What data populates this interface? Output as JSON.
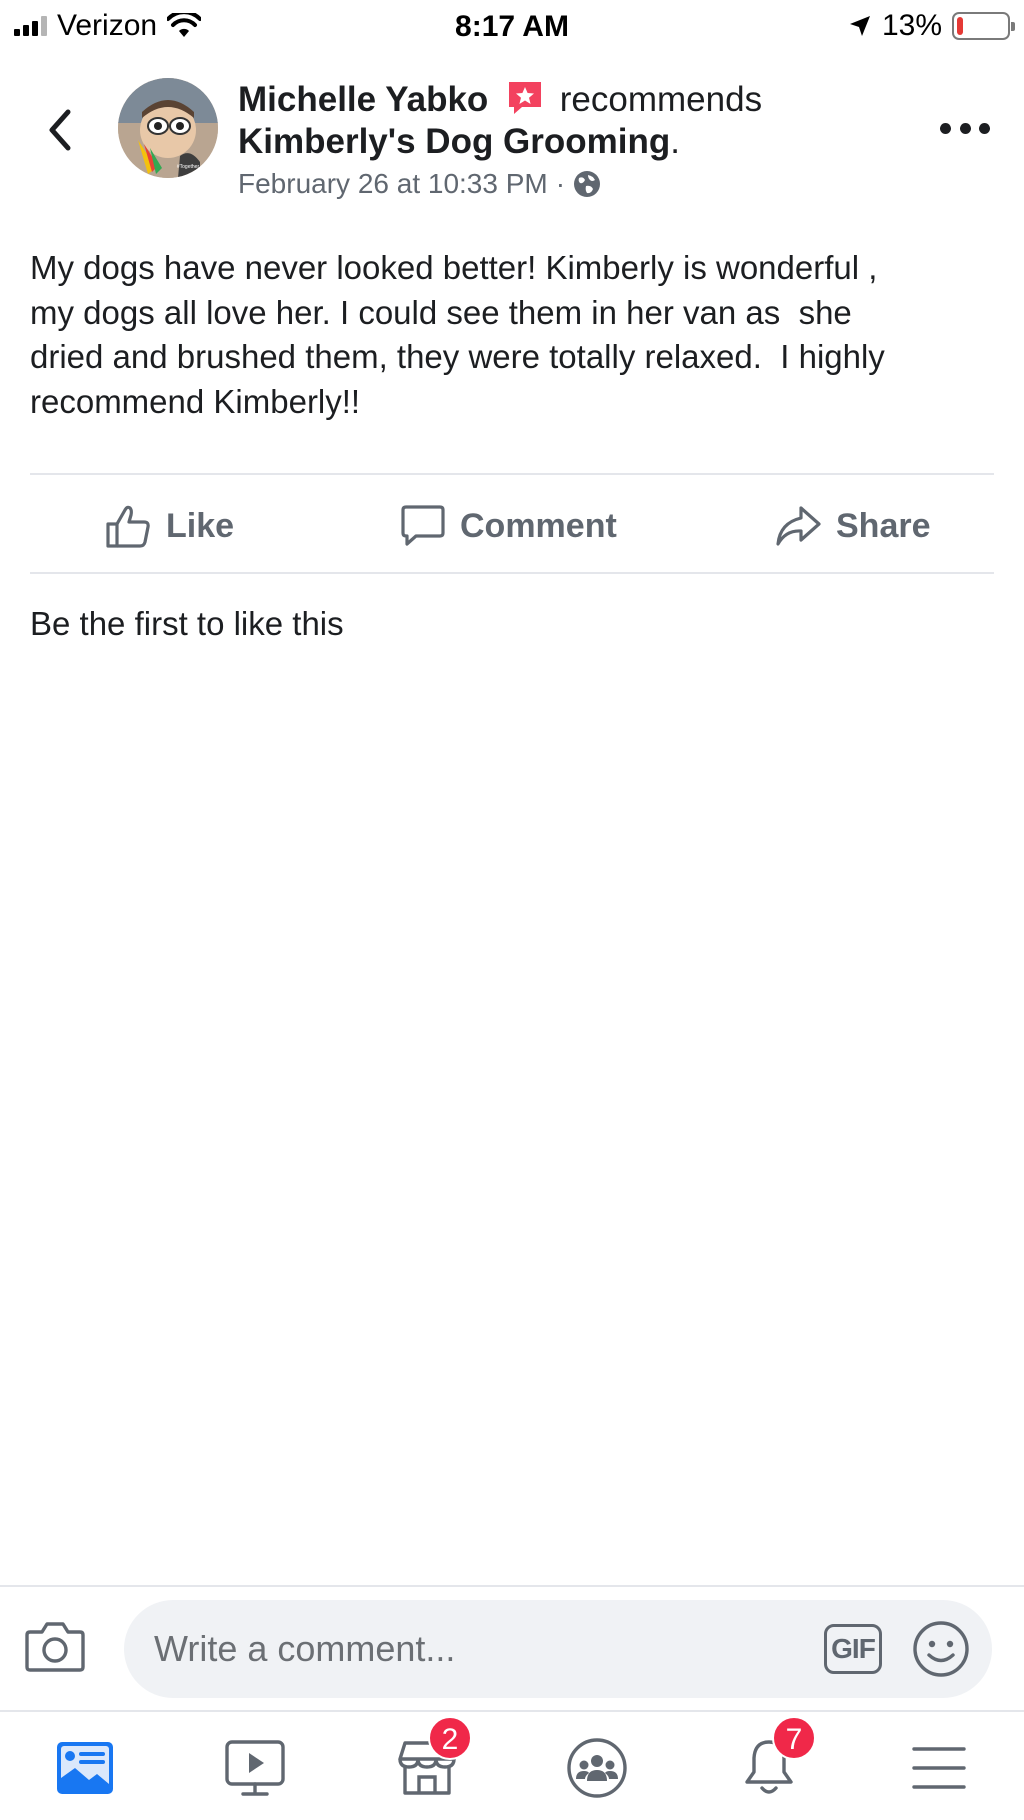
{
  "status_bar": {
    "carrier": "Verizon",
    "time": "8:17 AM",
    "battery_text": "13%",
    "battery_level": 0.13,
    "battery_color": "#e53935"
  },
  "post": {
    "author": "Michelle Yabko",
    "recommendation_icon": "recommendation-star-icon",
    "action_word": "recommends",
    "page_name": "Kimberly's Dog Grooming",
    "page_suffix": ".",
    "timestamp": "February 26 at 10:33 PM",
    "separator": "·",
    "privacy_icon": "globe-icon",
    "text": "My dogs have never looked better! Kimberly is wonderful ,\nmy dogs all love her. I could see them in her van as  she\ndried and brushed them, they were totally relaxed.  I highly\nrecommend Kimberly!!",
    "actions": {
      "like": "Like",
      "comment": "Comment",
      "share": "Share"
    },
    "likes_summary": "Be the first to like this"
  },
  "composer": {
    "placeholder": "Write a comment...",
    "gif_label": "GIF",
    "camera_icon": "camera-icon",
    "emoji_icon": "emoji-icon"
  },
  "tab_bar": {
    "tabs": [
      {
        "icon": "news-feed-icon",
        "badge": ""
      },
      {
        "icon": "watch-video-icon",
        "badge": ""
      },
      {
        "icon": "marketplace-icon",
        "badge": "2"
      },
      {
        "icon": "groups-icon",
        "badge": ""
      },
      {
        "icon": "notifications-bell-icon",
        "badge": "7"
      },
      {
        "icon": "menu-icon",
        "badge": ""
      }
    ],
    "active_color": "#1877f2",
    "badge_color": "#f02849"
  },
  "colors": {
    "recommend_badge": "#f3425f",
    "secondary_text": "#606770"
  }
}
